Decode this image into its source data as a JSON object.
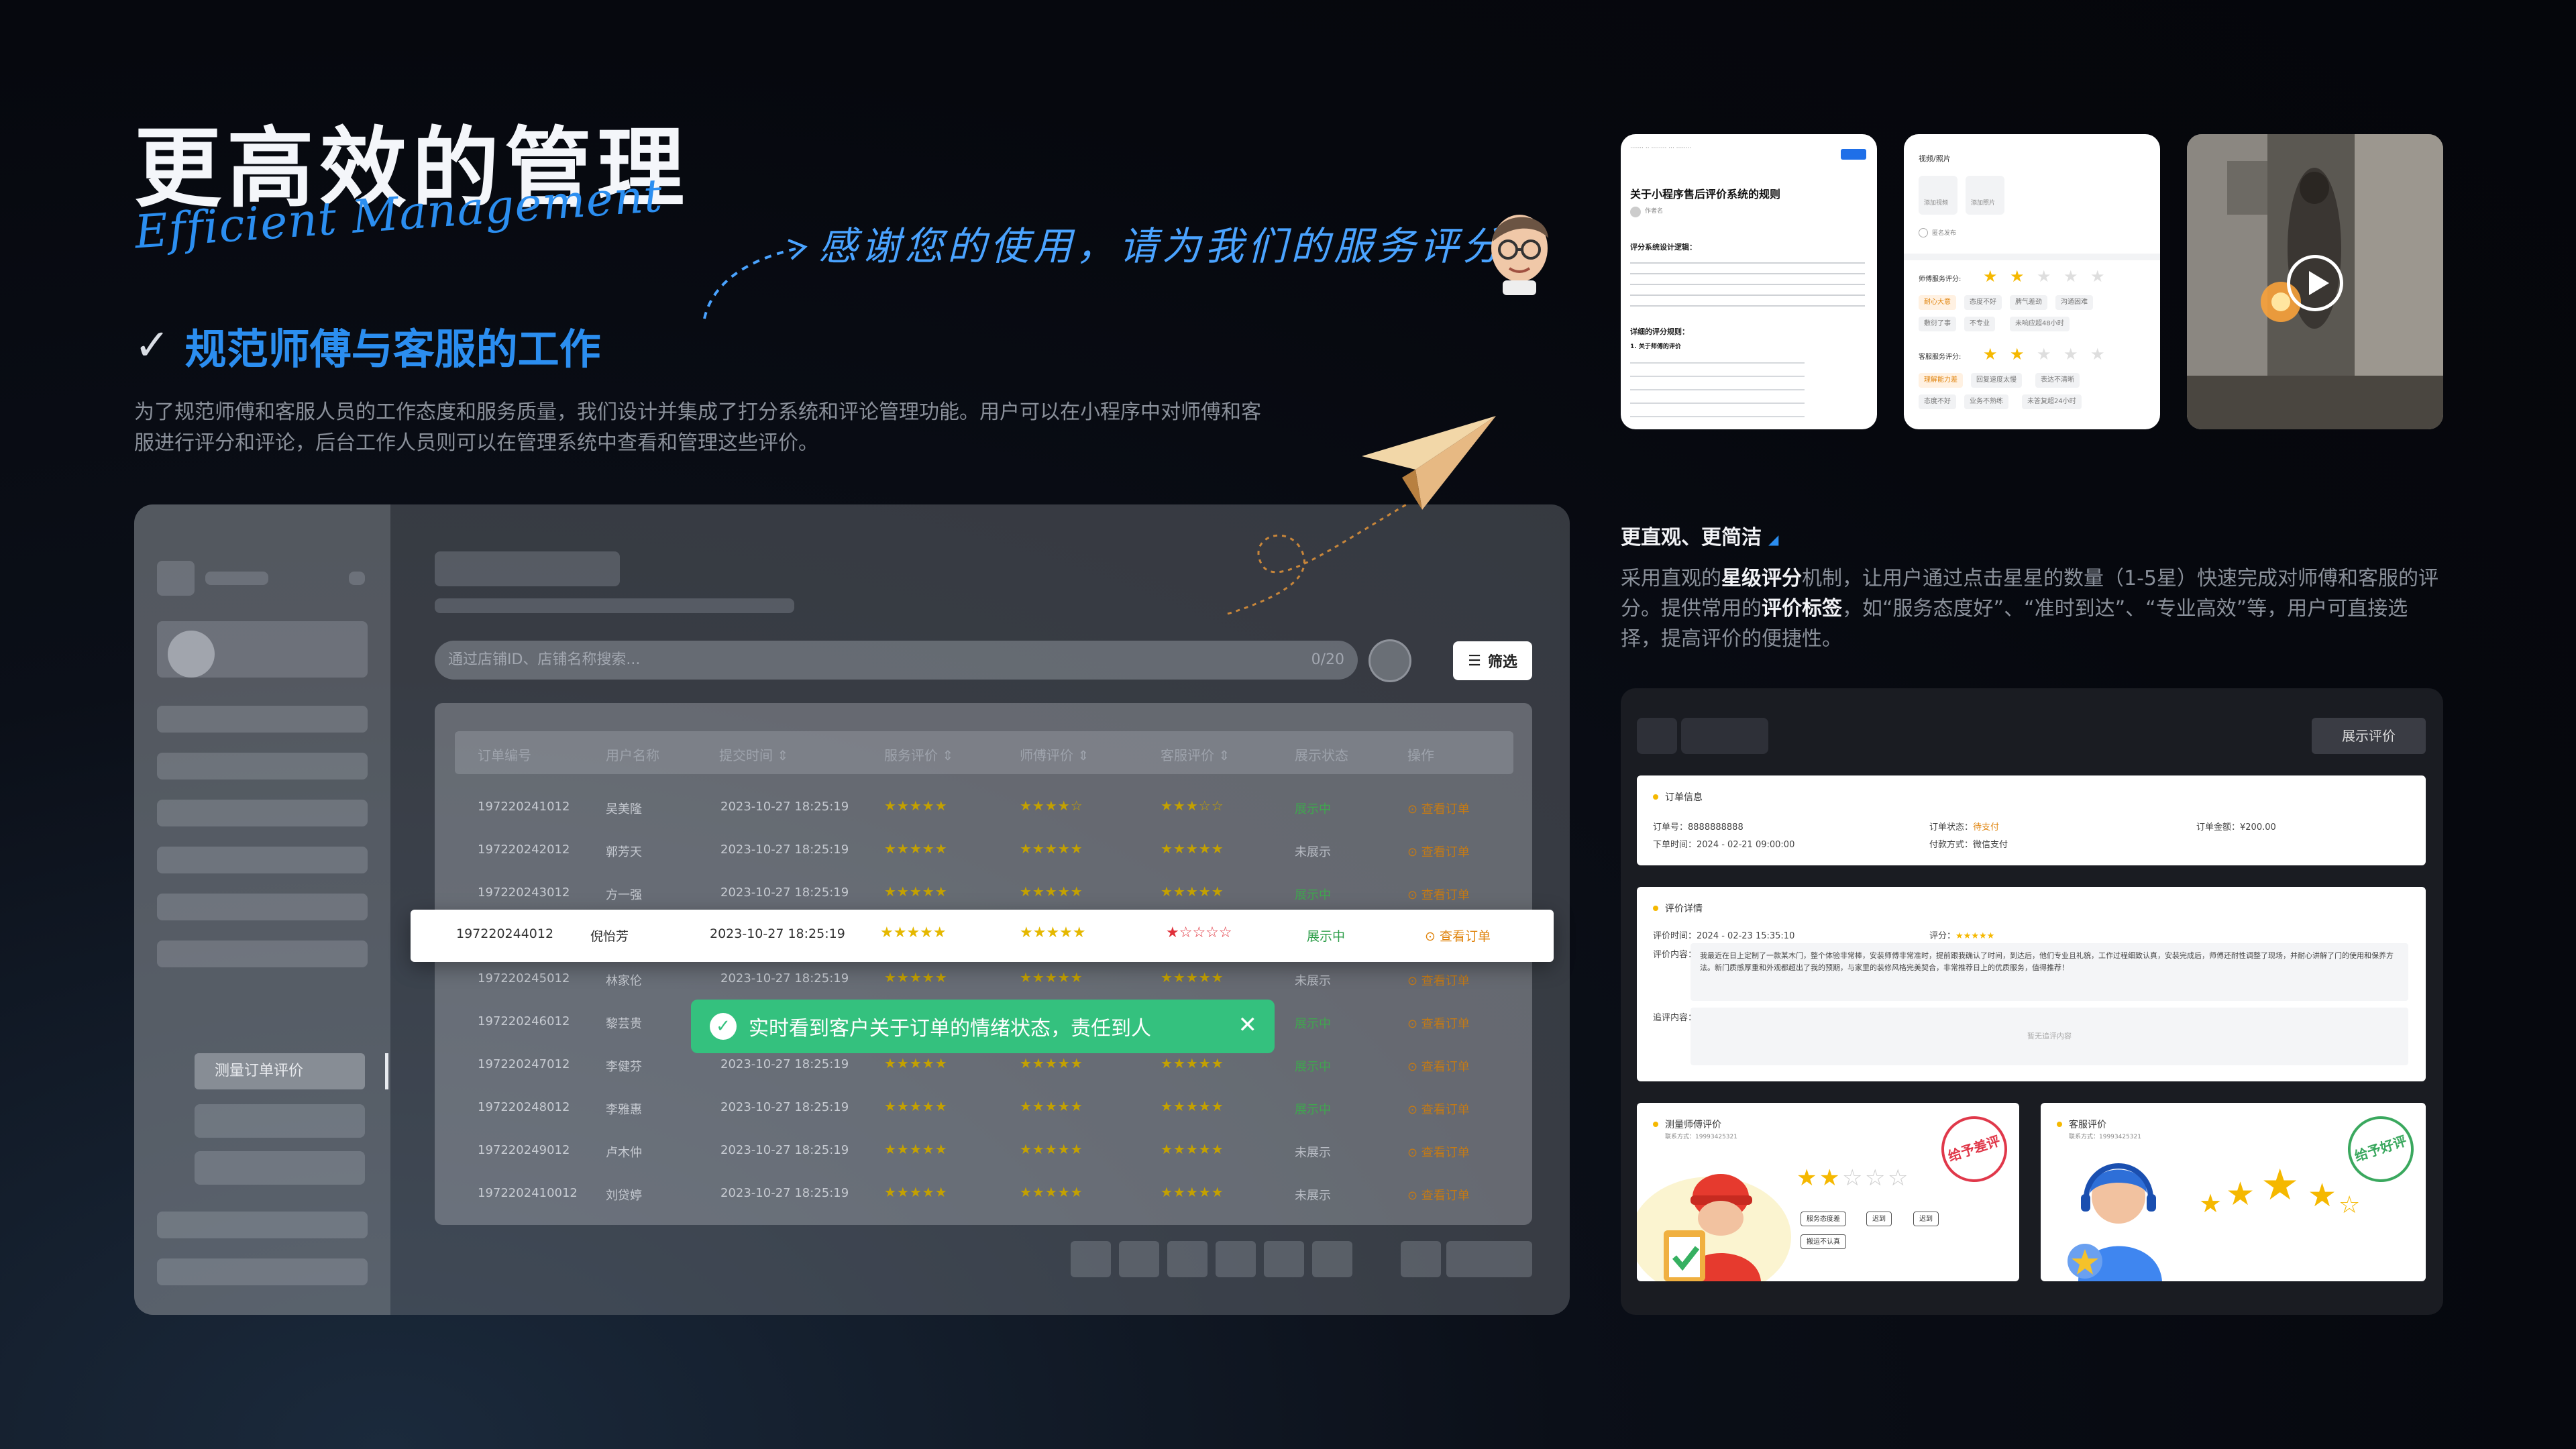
{
  "header": {
    "title": "更高效的管理",
    "script_subtitle": "Efficient Management",
    "thanks_line": "感谢您的使用，请为我们的服务评分",
    "subtitle": "规范师傅与客服的工作",
    "check": "✓",
    "description": "为了规范师傅和客服人员的工作态度和服务质量，我们设计并集成了打分系统和评论管理功能。用户可以在小程序中对师傅和客服进行评分和评论，后台工作人员则可以在管理系统中查看和管理这些评价。"
  },
  "mockup": {
    "sidebar_active": "测量订单评价",
    "search_placeholder": "通过店铺ID、店铺名称搜索...",
    "search_count": "0/20",
    "filter_label": "筛选",
    "columns": [
      "订单编号",
      "用户名称",
      "提交时间 ⇕",
      "服务评价 ⇕",
      "师傅评价 ⇕",
      "客服评价 ⇕",
      "展示状态",
      "操作"
    ],
    "rows": [
      {
        "id": "197220241012",
        "name": "吴美隆",
        "time": "2023-10-27 18:25:19",
        "s1": 5,
        "s2": 4,
        "s3": 3,
        "status": "展示中",
        "op": "⊙ 查看订单"
      },
      {
        "id": "197220242012",
        "name": "郭芳天",
        "time": "2023-10-27 18:25:19",
        "s1": 5,
        "s2": 5,
        "s3": 5,
        "status": "未展示",
        "op": "⊙ 查看订单"
      },
      {
        "id": "197220243012",
        "name": "方一强",
        "time": "2023-10-27 18:25:19",
        "s1": 5,
        "s2": 5,
        "s3": 5,
        "status": "展示中",
        "op": "⊙ 查看订单"
      },
      {
        "id": "197220245012",
        "name": "林家伦",
        "time": "2023-10-27 18:25:19",
        "s1": 5,
        "s2": 5,
        "s3": 5,
        "status": "未展示",
        "op": "⊙ 查看订单"
      },
      {
        "id": "197220246012",
        "name": "黎芸贵",
        "time": "2023-10-27 18:25:19",
        "s1": 5,
        "s2": 5,
        "s3": 5,
        "status": "展示中",
        "op": "⊙ 查看订单"
      },
      {
        "id": "197220247012",
        "name": "李健芬",
        "time": "2023-10-27 18:25:19",
        "s1": 5,
        "s2": 5,
        "s3": 5,
        "status": "展示中",
        "op": "⊙ 查看订单"
      },
      {
        "id": "197220248012",
        "name": "李雅惠",
        "time": "2023-10-27 18:25:19",
        "s1": 5,
        "s2": 5,
        "s3": 5,
        "status": "展示中",
        "op": "⊙ 查看订单"
      },
      {
        "id": "197220249012",
        "name": "卢木仲",
        "time": "2023-10-27 18:25:19",
        "s1": 5,
        "s2": 5,
        "s3": 5,
        "status": "未展示",
        "op": "⊙ 查看订单"
      },
      {
        "id": "1972202410012",
        "name": "刘贷婷",
        "time": "2023-10-27 18:25:19",
        "s1": 5,
        "s2": 5,
        "s3": 5,
        "status": "未展示",
        "op": "⊙ 查看订单"
      }
    ],
    "highlight": {
      "id": "197220244012",
      "name": "倪怡芳",
      "time": "2023-10-27 18:25:19",
      "stars_service": "★★★★★",
      "stars_master": "★★★★★",
      "stars_cs": "★☆☆☆☆",
      "status": "展示中",
      "op": "⊙ 查看订单"
    },
    "toast": "实时看到客户关于订单的情绪状态，责任到人",
    "toast_close": "✕"
  },
  "thumbs": {
    "rules_title": "关于小程序售后评价系统的规则",
    "rules_author": "作者名",
    "rules_h1": "评分系统设计逻辑：",
    "rules_h2": "详细的评分规则：",
    "rules_h3": "1. 关于师傅的评价",
    "video_label": "视频/照片",
    "add_video": "添加视频",
    "add_photo": "添加照片",
    "anonymous": "匿名发布",
    "master_rating": "师傅服务评分:",
    "cs_rating": "客服服务评分:",
    "master_tags": [
      "耐心大意",
      "态度不好",
      "脾气差劲",
      "沟通困难",
      "敷衍了事",
      "不专业",
      "未响应超48小时"
    ],
    "cs_tags": [
      "理解能力差",
      "回复速度太慢",
      "表达不清晰",
      "态度不好",
      "业务不熟练",
      "未答复超24小时"
    ]
  },
  "right": {
    "heading": "更直观、更简洁",
    "desc_1": "采用直观的",
    "desc_b1": "星级评分",
    "desc_2": "机制，让用户通过点击星星的数量（1-5星）快速完成对师傅和客服的评分。提供常用的",
    "desc_b2": "评价标签",
    "desc_3": "，如“服务态度好”、“准时到达”、“专业高效”等，用户可直接选择，提高评价的便捷性。",
    "show_btn": "展示评价",
    "order_info": "订单信息",
    "order_no": "订单号：",
    "order_no_val": "8888888888",
    "order_status": "订单状态：",
    "order_status_val": "待支付",
    "order_amount": "订单金额：",
    "order_amount_val": "¥200.00",
    "order_time": "下单时间：",
    "order_time_val": "2024 - 02-21 09:00:00",
    "pay_method": "付款方式：",
    "pay_method_val": "微信支付",
    "review_detail": "评价详情",
    "review_time": "评价时间：",
    "review_time_val": "2024 - 02-23 15:35:10",
    "score": "评分：",
    "review_content": "评价内容：",
    "review_text": "我最近在日上定制了一款某木门，整个体验非常棒，安装师傅非常准时，提前跟我确认了时间，到达后，他们专业且礼貌，工作过程细致认真，安装完成后，师傅还耐性调整了现场，并耐心讲解了门的使用和保养方法。新门质感厚重和外观都超出了我的预期，与家里的装修风格完美契合，非常推荐日上的优质服务，值得推荐！",
    "reply_content": "追评内容：",
    "reply_placeholder": "暂无追评内容",
    "master_review": "测量师傅评价",
    "master_phone": "联系方式：19993425321",
    "master_tags": [
      "服务态度差",
      "迟到",
      "迟到",
      "搬运不认真"
    ],
    "cs_review": "客服评价",
    "cs_phone": "联系方式：19993425321",
    "stamp_bad": "给予差评",
    "stamp_good": "给予好评"
  },
  "colors": {
    "accent": "#2b8ef0",
    "toast": "#34c17e",
    "star": "#f5b800",
    "orange": "#e0850f"
  }
}
